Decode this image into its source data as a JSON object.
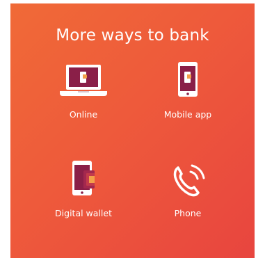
{
  "promo": {
    "title": "More ways to bank",
    "options": [
      {
        "label": "Online",
        "icon": "laptop-icon"
      },
      {
        "label": "Mobile app",
        "icon": "smartphone-icon"
      },
      {
        "label": "Digital wallet",
        "icon": "digital-wallet-icon"
      },
      {
        "label": "Phone",
        "icon": "phone-icon"
      }
    ]
  },
  "colors": {
    "gradient_start": "#f06a37",
    "gradient_end": "#e8453f",
    "icon_fill": "#8a1f48",
    "icon_accent": "#f3a04a",
    "text": "#ffffff"
  }
}
